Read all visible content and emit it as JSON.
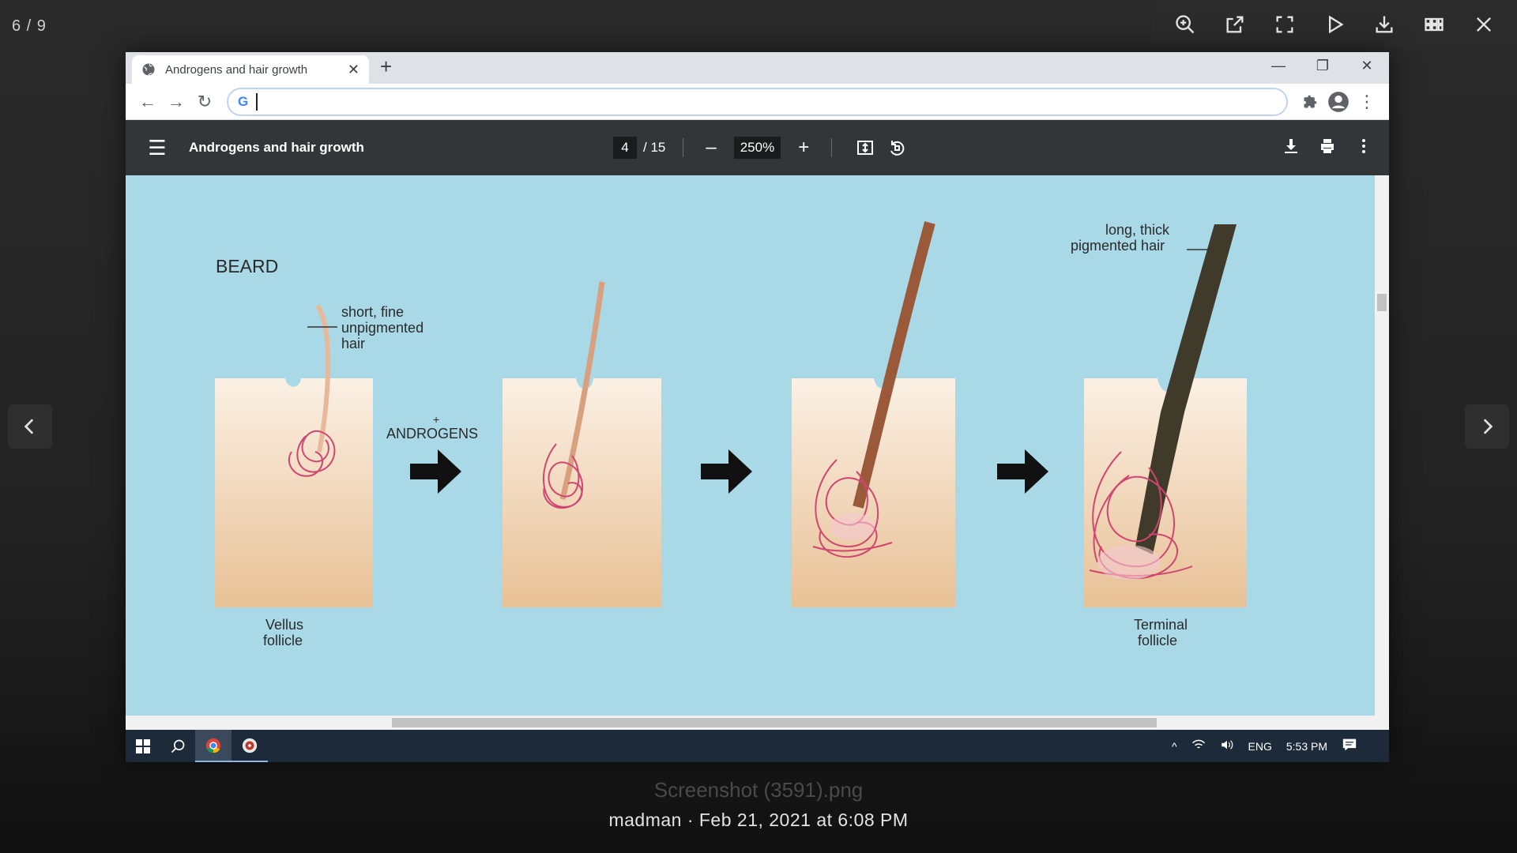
{
  "viewer": {
    "counter": "6 / 9",
    "caption_filename": "Screenshot (3591).png",
    "caption_meta": "madman · Feb 21, 2021 at 6:08 PM",
    "toolbar_icons": [
      "zoom-in-icon",
      "open-external-icon",
      "fullscreen-icon",
      "play-icon",
      "download-icon",
      "grid-icon",
      "close-icon"
    ]
  },
  "browser": {
    "tab_title": "Androgens and hair growth",
    "new_tab_label": "+",
    "address_value": "",
    "colors": {
      "tabstrip": "#dee1e6",
      "pdf_toolbar": "#323639"
    }
  },
  "pdf": {
    "title": "Androgens and hair growth",
    "current_page": "4",
    "total_pages": "/ 15",
    "zoom": "250%",
    "zoom_out": "–",
    "zoom_in": "+"
  },
  "diagram": {
    "beard": "BEARD",
    "short_line1": "short, fine",
    "short_line2": "unpigmented",
    "short_line3": "hair",
    "plus": "+",
    "androgens": "ANDROGENS",
    "vellus_line1": "Vellus",
    "vellus_line2": "follicle",
    "long_line1": "long, thick",
    "long_line2": "pigmented hair",
    "terminal_line1": "Terminal",
    "terminal_line2": "follicle"
  },
  "taskbar": {
    "language": "ENG",
    "time": "5:53 PM"
  }
}
